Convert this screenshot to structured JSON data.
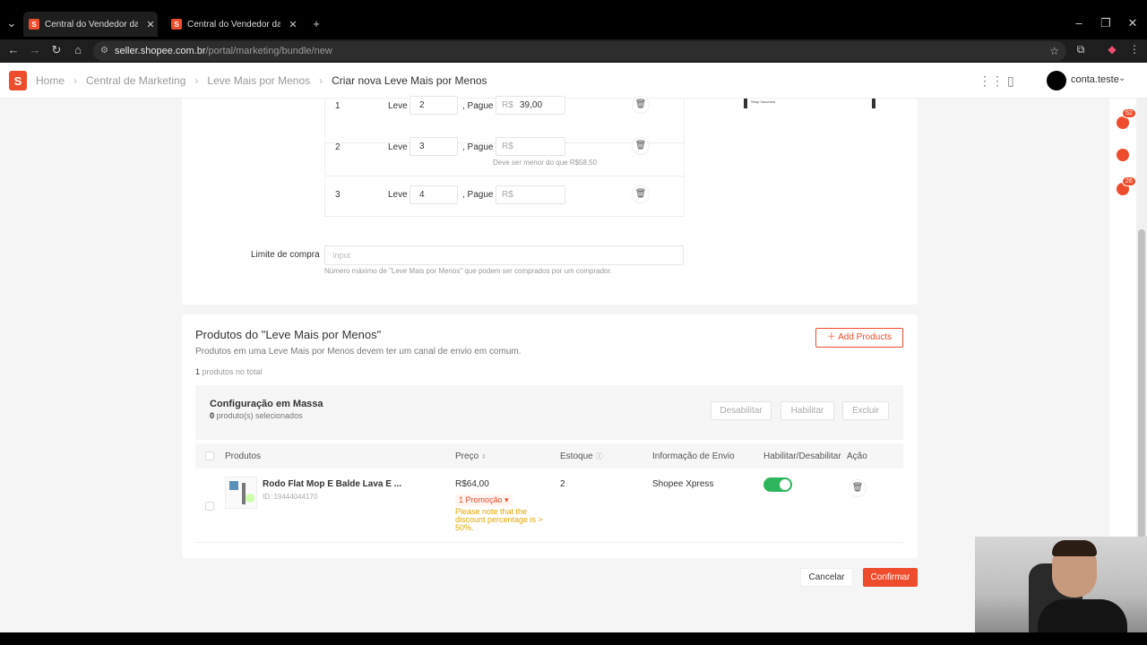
{
  "browser": {
    "tabs": [
      {
        "title": "Central do Vendedor da Shopee"
      },
      {
        "title": "Central do Vendedor da Shopee"
      }
    ],
    "url_host": "seller.shopee.com.br",
    "url_path": "/portal/marketing/bundle/new"
  },
  "header": {
    "logo_letter": "S",
    "breadcrumbs": [
      "Home",
      "Central de Marketing",
      "Leve Mais por Menos",
      "Criar nova Leve Mais por Menos"
    ],
    "account_name": "conta.teste"
  },
  "rail": {
    "badge_notifications": "52",
    "badge_chat": "26"
  },
  "tiers": [
    {
      "index": "1",
      "leve_label": "Leve",
      "quantity": "2",
      "pague_label": ", Pague",
      "currency": "R$",
      "price": "39,00"
    },
    {
      "index": "2",
      "leve_label": "Leve",
      "quantity": "3",
      "pague_label": ", Pague",
      "currency": "R$",
      "price": "",
      "hint": "Deve ser menor do que R$58,50"
    },
    {
      "index": "3",
      "leve_label": "Leve",
      "quantity": "4",
      "pague_label": ", Pague",
      "currency": "R$",
      "price": ""
    }
  ],
  "preview": {
    "text": "Shop Vouchers"
  },
  "limit": {
    "label": "Limite de compra",
    "placeholder": "Input",
    "hint": "Número máximo de \"Leve Mais por Menos\" que podem ser comprados por um comprador."
  },
  "products": {
    "title": "Produtos do \"Leve Mais por Menos\"",
    "subtitle": "Produtos em uma Leve Mais por Menos devem ter um canal de envio em comum.",
    "add_button": "Add Products",
    "total_count": "1",
    "total_label": " produtos no total",
    "mass": {
      "title": "Configuração em Massa",
      "selected_count": "0",
      "selected_label": " produto(s) selecionados",
      "buttons": [
        "Desabilitar",
        "Habilitar",
        "Excluir"
      ]
    },
    "columns": [
      "Produtos",
      "Preço",
      "Estoque",
      "Informação de Envio",
      "Habilitar/Desabilitar",
      "Ação"
    ],
    "rows": [
      {
        "name": "Rodo Flat Mop E Balde Lava E ...",
        "id": "ID: 19444044170",
        "price": "R$64,00",
        "promo": "1 Promoção ▾",
        "warning": "Please note that the discount percentage is > 50%.",
        "stock": "2",
        "shipping": "Shopee Xpress",
        "enabled": true
      }
    ]
  },
  "footer": {
    "cancel": "Cancelar",
    "confirm": "Confirmar"
  },
  "colors": {
    "brand": "#ee4d2d",
    "toggle_on": "#2db55d",
    "warning": "#e0a800"
  }
}
